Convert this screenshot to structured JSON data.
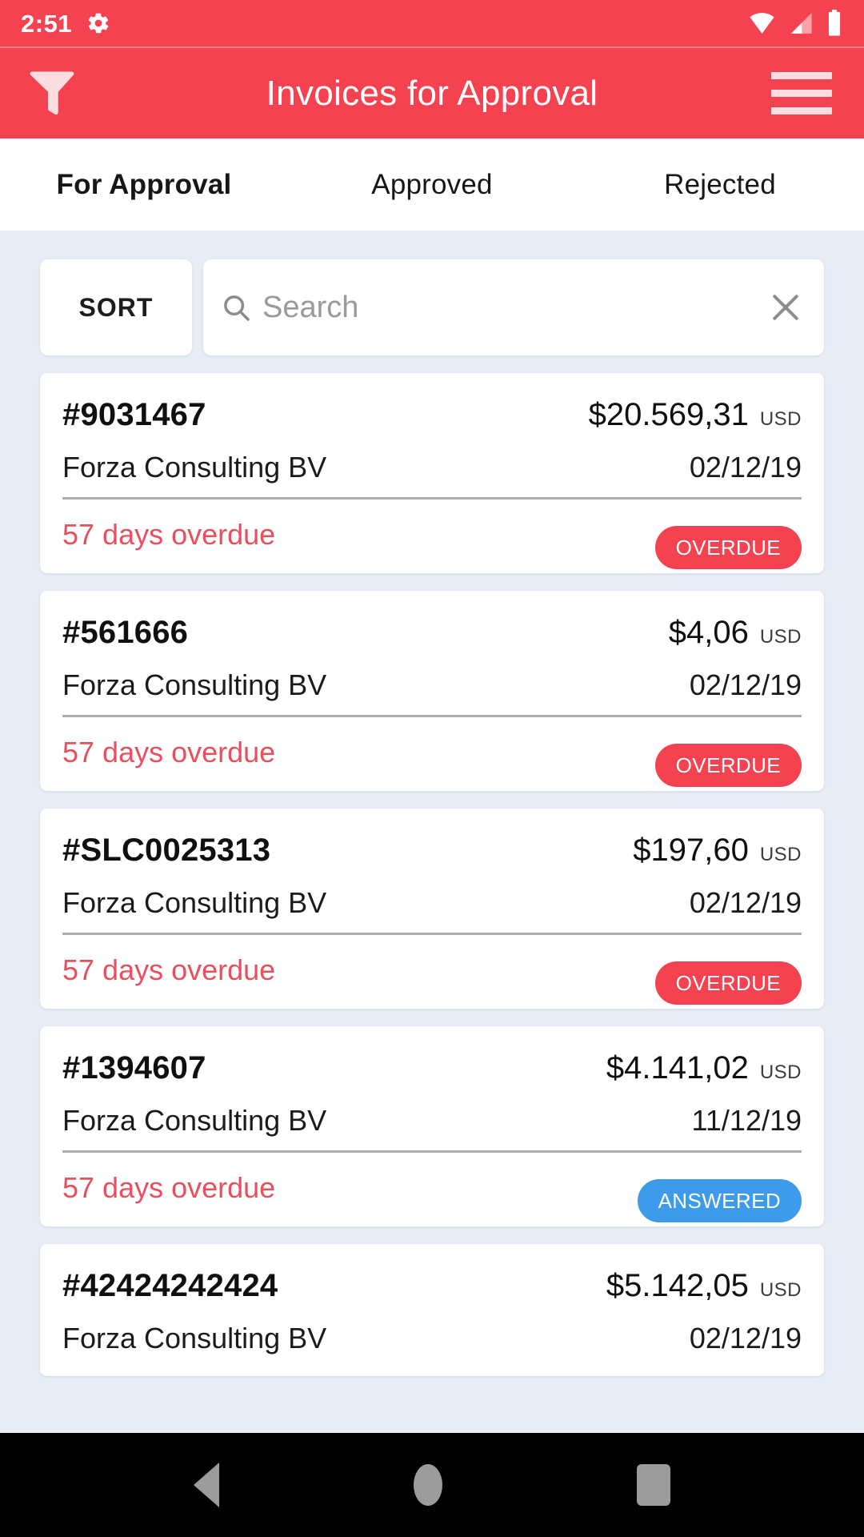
{
  "status_bar": {
    "time": "2:51",
    "icons": [
      "gear-icon",
      "wifi-icon",
      "cellular-signal-icon",
      "battery-icon"
    ]
  },
  "app_bar": {
    "title": "Invoices for Approval",
    "filter_icon": "filter-funnel-icon",
    "menu_icon": "hamburger-menu-icon",
    "background_color": "#F44250"
  },
  "tabs": [
    {
      "label": "For Approval",
      "active": true
    },
    {
      "label": "Approved",
      "active": false
    },
    {
      "label": "Rejected",
      "active": false
    }
  ],
  "toolbar": {
    "sort_label": "SORT",
    "search_placeholder": "Search",
    "search_value": "",
    "search_icon": "search-icon",
    "clear_icon": "close-x-icon"
  },
  "invoices": [
    {
      "number": "#9031467",
      "amount": "$20.569,31",
      "currency": "USD",
      "vendor": "Forza Consulting BV",
      "date": "02/12/19",
      "status_text": "57 days overdue",
      "badge": "OVERDUE",
      "badge_color": "#F44250",
      "has_footer": true
    },
    {
      "number": "#561666",
      "amount": "$4,06",
      "currency": "USD",
      "vendor": "Forza Consulting BV",
      "date": "02/12/19",
      "status_text": "57 days overdue",
      "badge": "OVERDUE",
      "badge_color": "#F44250",
      "has_footer": true
    },
    {
      "number": "#SLC0025313",
      "amount": "$197,60",
      "currency": "USD",
      "vendor": "Forza Consulting BV",
      "date": "02/12/19",
      "status_text": "57 days overdue",
      "badge": "OVERDUE",
      "badge_color": "#F44250",
      "has_footer": true
    },
    {
      "number": "#1394607",
      "amount": "$4.141,02",
      "currency": "USD",
      "vendor": "Forza Consulting BV",
      "date": "11/12/19",
      "status_text": "57 days overdue",
      "badge": "ANSWERED",
      "badge_color": "#3D9BE9",
      "has_footer": true
    },
    {
      "number": "#42424242424",
      "amount": "$5.142,05",
      "currency": "USD",
      "vendor": "Forza Consulting BV",
      "date": "02/12/19",
      "status_text": "",
      "badge": "",
      "badge_color": "",
      "has_footer": false
    }
  ],
  "nav_bar": {
    "back_icon": "back-triangle-icon",
    "home_icon": "home-circle-icon",
    "recents_icon": "recents-square-icon"
  },
  "colors": {
    "accent_red": "#F44250",
    "status_blue": "#3D9BE9",
    "page_background": "#E8ECF5",
    "overdue_text": "#E8505E"
  }
}
